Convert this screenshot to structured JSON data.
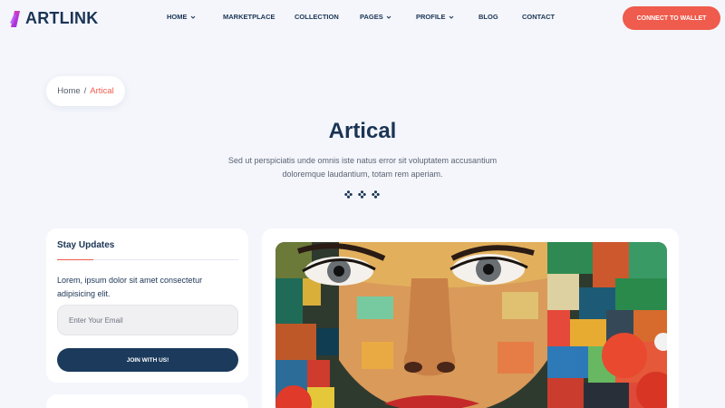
{
  "brand": {
    "name": "ARTLINK"
  },
  "nav": {
    "items": [
      {
        "label": "HOME",
        "has_dropdown": true
      },
      {
        "label": "MARKETPLACE",
        "has_dropdown": false
      },
      {
        "label": "COLLECTION",
        "has_dropdown": false
      },
      {
        "label": "PAGES",
        "has_dropdown": true
      },
      {
        "label": "PROFILE",
        "has_dropdown": true
      },
      {
        "label": "BLOG",
        "has_dropdown": false
      },
      {
        "label": "CONTACT",
        "has_dropdown": false
      }
    ],
    "cta_label": "CONNECT TO WALLET"
  },
  "breadcrumb": {
    "home": "Home",
    "separator": "/",
    "current": "Artical"
  },
  "hero": {
    "title": "Artical",
    "description": "Sed ut perspiciatis unde omnis iste natus error sit voluptatem accusantium doloremque laudantium, totam rem aperiam."
  },
  "sidebar": {
    "newsletter": {
      "title": "Stay Updates",
      "text": "Lorem, ipsum dolor sit amet consectetur adipisicing elit.",
      "email_placeholder": "Enter Your Email",
      "email_value": "",
      "button_label": "JOIN WITH US!"
    }
  },
  "colors": {
    "accent": "#ef5b4c",
    "navy": "#1b3454",
    "button_dark": "#1b3a5c",
    "background": "#f4f6fc",
    "logo_gradient": [
      "#ff3fa5",
      "#7b2ff7"
    ]
  },
  "icons": {
    "logo": "artlink-logo-icon",
    "nav_dropdown": "chevron-down-icon",
    "ornament": "flower-icon"
  }
}
